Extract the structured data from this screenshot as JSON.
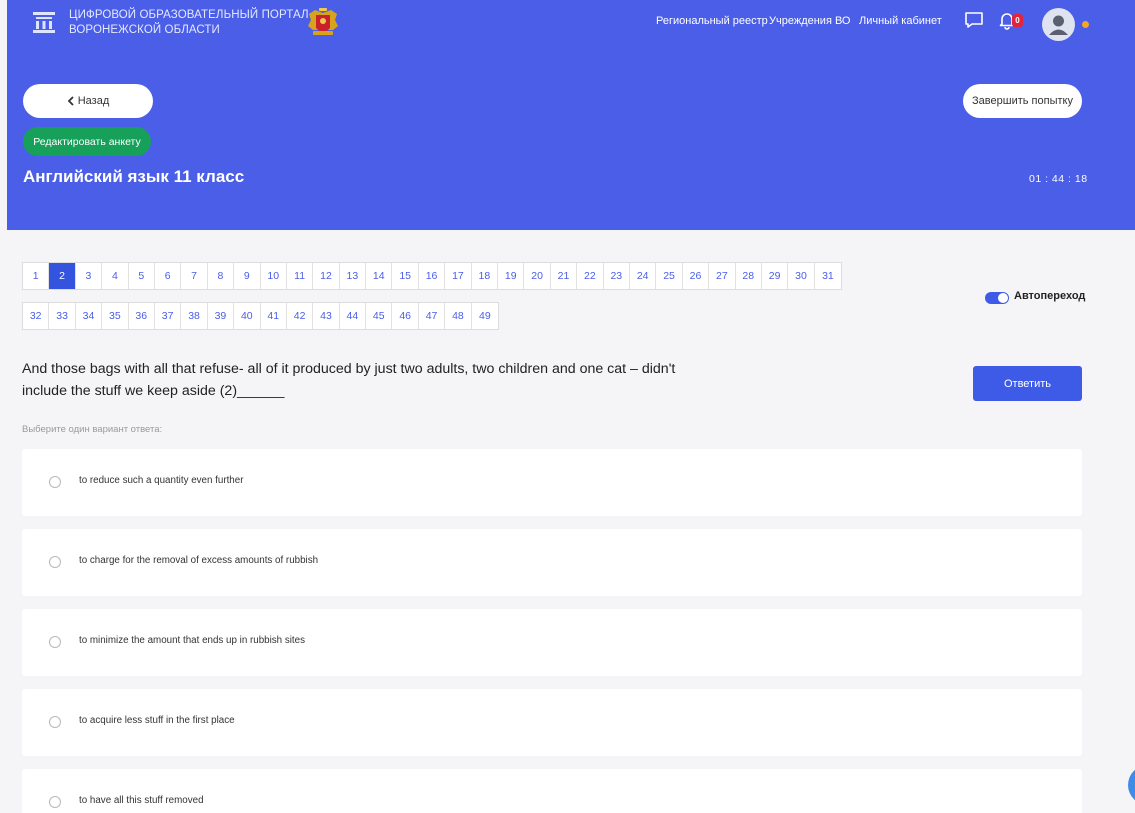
{
  "header": {
    "portal_title_line1": "ЦИФРОВОЙ ОБРАЗОВАТЕЛЬНЫЙ ПОРТАЛ",
    "portal_title_line2": "ВОРОНЕЖСКОЙ ОБЛАСТИ",
    "nav": {
      "registry": "Региональный реестр",
      "institutions": "Учреждения ВО",
      "cabinet": "Личный кабинет"
    },
    "notifications_count": "0",
    "accent_color": "#4a5ee8"
  },
  "actions": {
    "back_label": "Назад",
    "finish_label": "Завершить попытку",
    "edit_label": "Редактировать анкету"
  },
  "test": {
    "title": "Английский язык 11 класс",
    "timer": "01 : 44 : 18"
  },
  "question_nav": {
    "row1": [
      "1",
      "2",
      "3",
      "4",
      "5",
      "6",
      "7",
      "8",
      "9",
      "10",
      "11",
      "12",
      "13",
      "14",
      "15",
      "16",
      "17",
      "18",
      "19",
      "20",
      "21",
      "22",
      "23",
      "24",
      "25",
      "26",
      "27",
      "28",
      "29",
      "30",
      "31"
    ],
    "row2": [
      "32",
      "33",
      "34",
      "35",
      "36",
      "37",
      "38",
      "39",
      "40",
      "41",
      "42",
      "43",
      "44",
      "45",
      "46",
      "47",
      "48",
      "49"
    ],
    "active": "2"
  },
  "autoadvance": {
    "label": "Автопереход",
    "enabled": true
  },
  "question": {
    "text": "And those bags with all that refuse- all of it produced by just two adults, two children and one cat – didn't include the stuff we keep aside (2)______",
    "answer_label": "Ответить",
    "hint": "Выберите один вариант ответа:",
    "options": [
      "to reduce such a quantity even further",
      "to charge for the removal of excess amounts of rubbish",
      "to minimize the amount that ends up in rubbish sites",
      "to acquire less stuff in the first place",
      "to have all this stuff removed"
    ]
  }
}
